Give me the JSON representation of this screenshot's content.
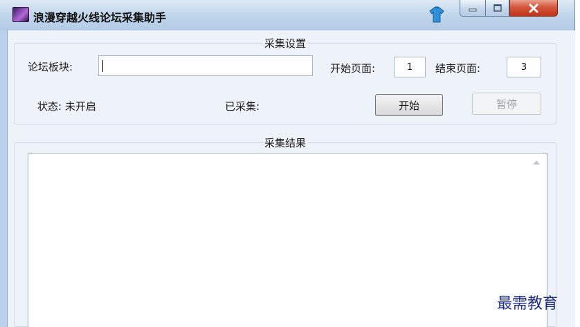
{
  "window": {
    "title": "浪漫穿越火线论坛采集助手",
    "icon": "app-icon",
    "controls": [
      "minimize-icon",
      "maximize-icon",
      "close-icon"
    ]
  },
  "settings": {
    "legend": "采集设置",
    "board_label": "论坛板块:",
    "board_value": "",
    "start_page_label": "开始页面:",
    "start_page_value": "1",
    "end_page_label": "结束页面:",
    "end_page_value": "3",
    "status_label": "状态: 未开启",
    "collected_label": "已采集:",
    "start_button": "开始",
    "pause_button": "暂停"
  },
  "results": {
    "legend": "采集结果",
    "content": ""
  },
  "watermark": "最需教育",
  "colors": {
    "titlebar": "#c3d7ec",
    "client_bg": "#eef3f9",
    "close_button": "#d3573c",
    "disabled_text": "#a0a0a0",
    "watermark": "#1f2f8a"
  }
}
